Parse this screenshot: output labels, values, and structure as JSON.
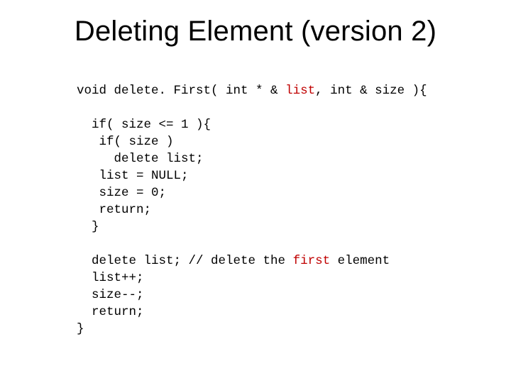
{
  "title": "Deleting Element (version 2)",
  "code": {
    "sig_void": "void",
    "sig_fn": " delete. First( ",
    "sig_t1": "int * &",
    "sig_p1": " list",
    "sig_c1": ", ",
    "sig_t2": "int &",
    "sig_p2": " size",
    "sig_end": " ){",
    "l3": "  if( size <= 1 ){",
    "l4": "   if( size )",
    "l5": "     delete list;",
    "l6": "   list = NULL;",
    "l7": "   size = 0;",
    "l8": "   return;",
    "l9": "  }",
    "l11_a": "  delete list; // delete the ",
    "l11_b": "first",
    "l11_c": " element",
    "l12": "  list++;",
    "l13": "  size--;",
    "l14": "  return;",
    "l15": "}"
  }
}
